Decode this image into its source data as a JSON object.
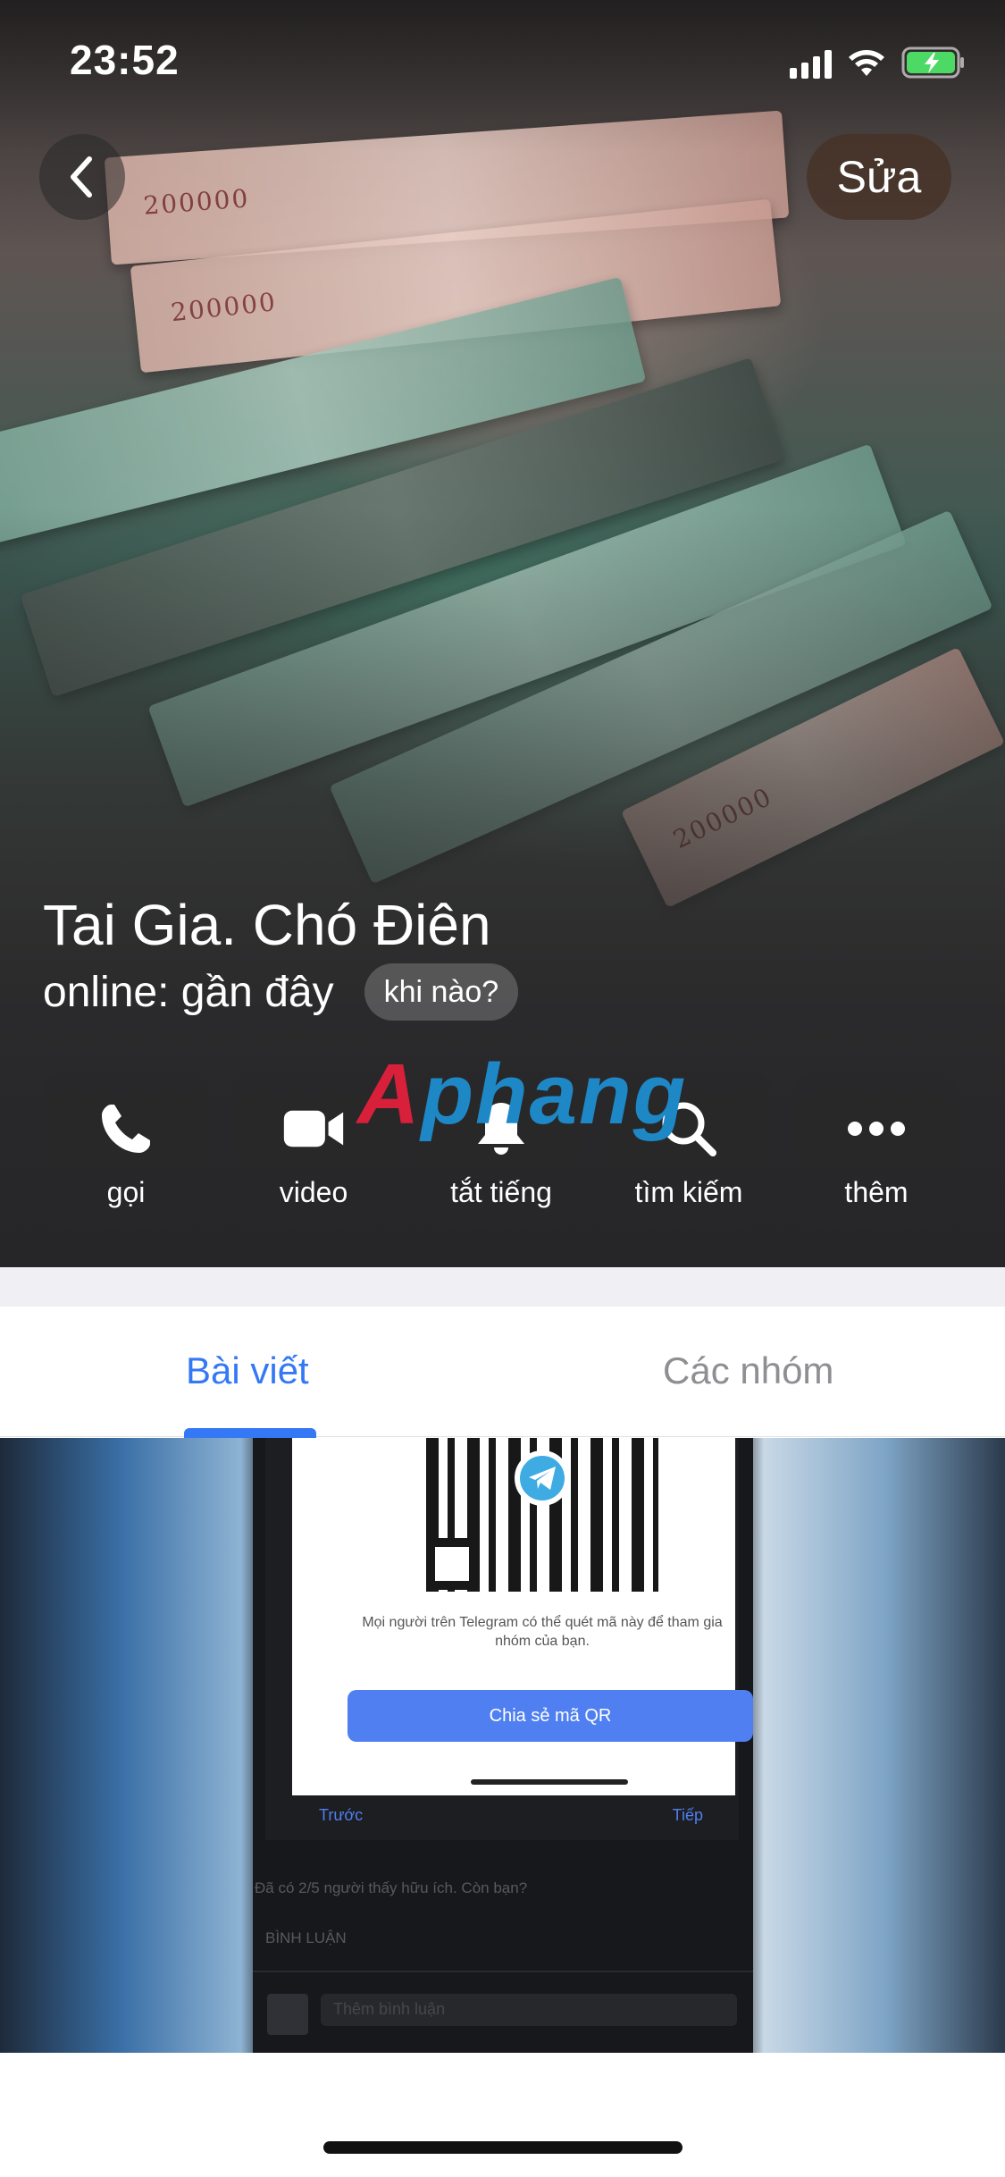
{
  "status_bar": {
    "time": "23:52",
    "icons": [
      "cellular-signal-icon",
      "wifi-icon",
      "battery-charging-icon"
    ],
    "battery_color": "#4cd964"
  },
  "header": {
    "back_icon": "chevron-left-icon",
    "edit_label": "Sửa",
    "photo_banknote_labels": [
      "200000",
      "200000",
      "200000"
    ]
  },
  "profile": {
    "name": "Tai Gia. Chó Điên",
    "status": "online: gần đây",
    "when_chip": "khi nào?"
  },
  "watermark": {
    "first": "A",
    "rest": "phang"
  },
  "actions": [
    {
      "label": "gọi",
      "icon": "phone-icon"
    },
    {
      "label": "video",
      "icon": "video-camera-icon"
    },
    {
      "label": "tắt tiếng",
      "icon": "bell-icon"
    },
    {
      "label": "tìm kiếm",
      "icon": "search-icon"
    },
    {
      "label": "thêm",
      "icon": "more-dots-icon"
    }
  ],
  "tabs": {
    "posts": "Bài viết",
    "groups": "Các nhóm",
    "active": "posts"
  },
  "media": {
    "qr_text": "Mọi người trên Telegram có thể quét mã này để tham gia nhóm của bạn.",
    "share_button": "Chia sẻ mã QR",
    "prev": "Trước",
    "next": "Tiếp",
    "helpful": "Đã có 2/5 người thấy hữu ích. Còn bạn?",
    "comment_label": "BÌNH LUẬN",
    "comment_placeholder": "Thêm bình luận"
  },
  "colors": {
    "accent": "#3478f6",
    "tab_inactive": "#8e8e93",
    "band": "#efeff4"
  }
}
